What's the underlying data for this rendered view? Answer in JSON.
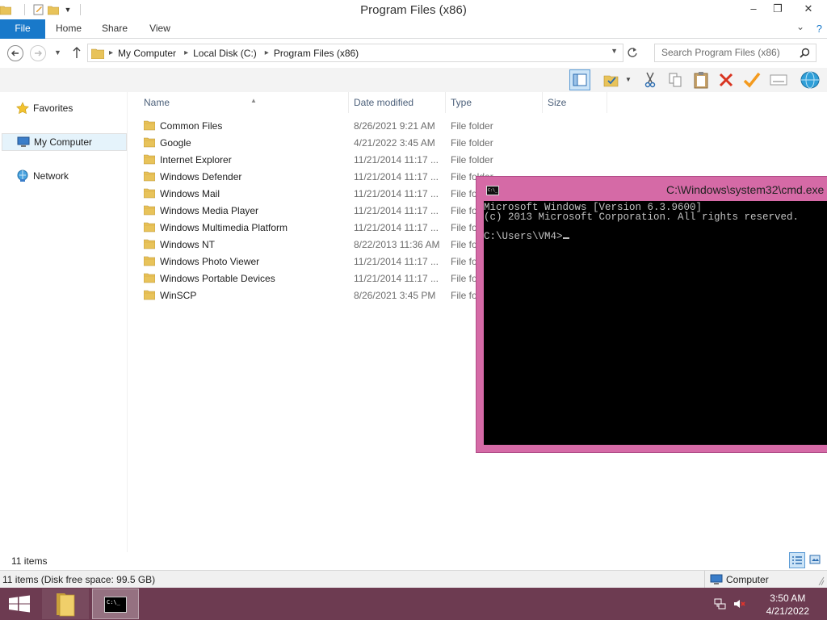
{
  "window": {
    "title": "Program Files (x86)",
    "minimize": "–",
    "maximize": "❐",
    "close": "✕"
  },
  "ribbon": {
    "tabs": [
      "File",
      "Home",
      "Share",
      "View"
    ],
    "help": "?",
    "expand": "⌄"
  },
  "address": {
    "crumbs": [
      "My Computer",
      "Local Disk (C:)",
      "Program Files (x86)"
    ],
    "search_placeholder": "Search Program Files (x86)"
  },
  "nav": {
    "favorites": "Favorites",
    "my_computer": "My Computer",
    "network": "Network"
  },
  "columns": {
    "name": "Name",
    "date": "Date modified",
    "type": "Type",
    "size": "Size"
  },
  "files": [
    {
      "name": "Common Files",
      "date": "8/26/2021 9:21 AM",
      "type": "File folder"
    },
    {
      "name": "Google",
      "date": "4/21/2022 3:45 AM",
      "type": "File folder"
    },
    {
      "name": "Internet Explorer",
      "date": "11/21/2014 11:17 ...",
      "type": "File folder"
    },
    {
      "name": "Windows Defender",
      "date": "11/21/2014 11:17 ...",
      "type": "File folder"
    },
    {
      "name": "Windows Mail",
      "date": "11/21/2014 11:17 ...",
      "type": "File fo"
    },
    {
      "name": "Windows Media Player",
      "date": "11/21/2014 11:17 ...",
      "type": "File fo"
    },
    {
      "name": "Windows Multimedia Platform",
      "date": "11/21/2014 11:17 ...",
      "type": "File fo"
    },
    {
      "name": "Windows NT",
      "date": "8/22/2013 11:36 AM",
      "type": "File fo"
    },
    {
      "name": "Windows Photo Viewer",
      "date": "11/21/2014 11:17 ...",
      "type": "File fo"
    },
    {
      "name": "Windows Portable Devices",
      "date": "11/21/2014 11:17 ...",
      "type": "File fo"
    },
    {
      "name": "WinSCP",
      "date": "8/26/2021 3:45 PM",
      "type": "File fo"
    }
  ],
  "status": {
    "item_count": "11 items",
    "disk_info": "11 items (Disk free space: 99.5 GB)",
    "zone": "Computer"
  },
  "cmd": {
    "title": "C:\\Windows\\system32\\cmd.exe",
    "icon_text": "C:\\_",
    "lines": [
      "Microsoft Windows [Version 6.3.9600]",
      "(c) 2013 Microsoft Corporation. All rights reserved.",
      "",
      "C:\\Users\\VM4>"
    ]
  },
  "taskbar": {
    "time": "3:50 AM",
    "date": "4/21/2022",
    "cmd_icon_text": "C:\\_"
  },
  "colors": {
    "file_tab": "#1979ca",
    "taskbar": "#6d3b51",
    "cmd_frame": "#d56aa6",
    "folder": "#e8c35a"
  }
}
